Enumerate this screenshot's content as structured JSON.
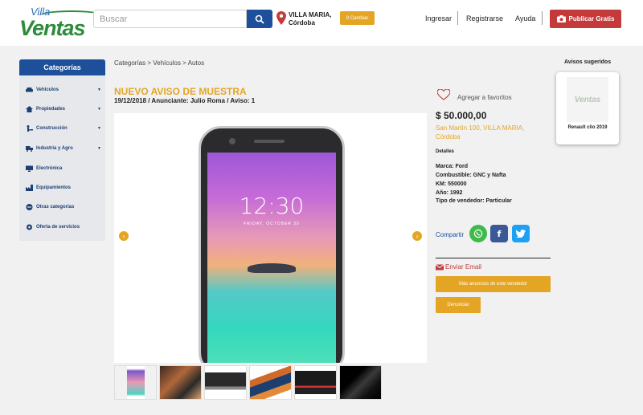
{
  "header": {
    "logo_top": "Villa",
    "logo_main": "Ventas",
    "search_placeholder": "Buscar",
    "location_city": "VILLA MARIA,",
    "location_province": "Córdoba",
    "change_label": "9 Cambiar",
    "nav": [
      "Ingresar",
      "Registrarse",
      "Ayuda"
    ],
    "publish_label": "Publicar Gratis"
  },
  "sidebar": {
    "title": "Categorías",
    "items": [
      {
        "label": "Vehículos",
        "icon": "car-icon",
        "has_submenu": true
      },
      {
        "label": "Propiedades",
        "icon": "house-icon",
        "has_submenu": true
      },
      {
        "label": "Construcción",
        "icon": "worker-icon",
        "has_submenu": true
      },
      {
        "label": "Industria y Agro",
        "icon": "truck-icon",
        "has_submenu": true
      },
      {
        "label": "Electrónica",
        "icon": "monitor-icon",
        "has_submenu": false
      },
      {
        "label": "Equipamientos",
        "icon": "factory-icon",
        "has_submenu": false
      },
      {
        "label": "Otras categorías",
        "icon": "dots-icon",
        "has_submenu": false
      },
      {
        "label": "Oferta de servicios",
        "icon": "gear-icon",
        "has_submenu": false
      }
    ]
  },
  "breadcrumb": "Categorías > Vehículos > Autos",
  "ad": {
    "title": "NUEVO AVISO DE MUESTRA",
    "meta": "19/12/2018 / Anunciante: Julio Roma / Aviso: 1",
    "phone_clock": "12:30",
    "phone_date": "FRIDAY, OCTOBER 30"
  },
  "details": {
    "favorite_label": "Agregar a favoritos",
    "price": "$ 50.000,00",
    "address": "San Martín 100, VILLA MARIA, Córdoba",
    "section_title": "Detalles",
    "rows": [
      "Marca: Ford",
      "Combustible: GNC y Nafta",
      "KM: 550000",
      "Año: 1992",
      "Tipo de vendedor: Particular"
    ],
    "share_label": "Compartir",
    "email_label": "Enviar Email",
    "more_label": "Más anuncios de este vendedor",
    "report_label": "Denunciar"
  },
  "suggested": {
    "title": "Avisos sugeridos",
    "items": [
      {
        "label": "Renault clio 2019"
      }
    ]
  },
  "colors": {
    "brand_blue": "#1e4f9a",
    "accent_orange": "#e5a524",
    "publish_red": "#c43a3a"
  }
}
